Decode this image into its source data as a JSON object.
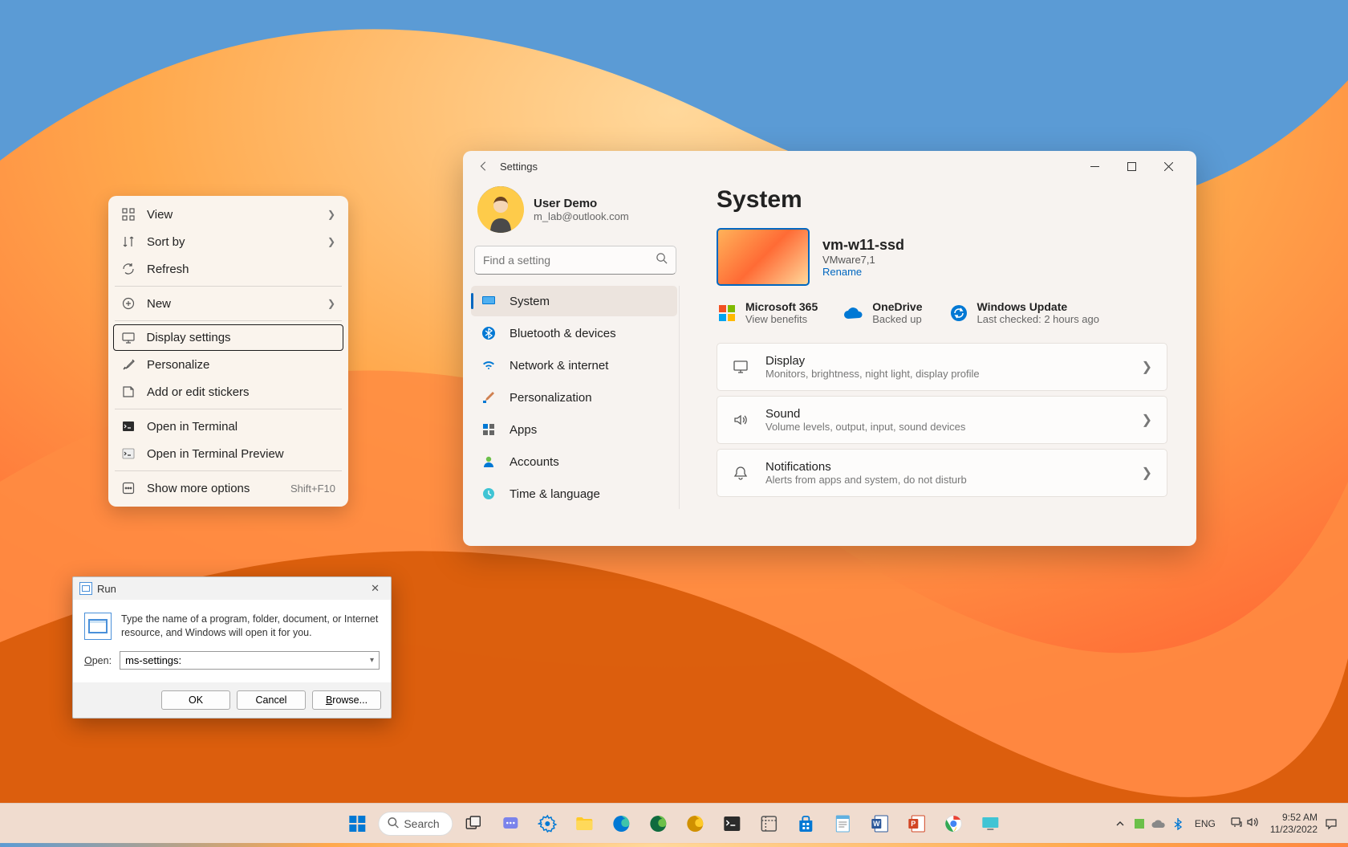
{
  "context_menu": {
    "items": [
      {
        "label": "View",
        "icon": "grid",
        "has_submenu": true
      },
      {
        "label": "Sort by",
        "icon": "sort",
        "has_submenu": true
      },
      {
        "label": "Refresh",
        "icon": "refresh"
      },
      {
        "sep": true
      },
      {
        "label": "New",
        "icon": "plus-circle",
        "has_submenu": true
      },
      {
        "sep": true
      },
      {
        "label": "Display settings",
        "icon": "display",
        "selected": true
      },
      {
        "label": "Personalize",
        "icon": "brush"
      },
      {
        "label": "Add or edit stickers",
        "icon": "sticker"
      },
      {
        "sep": true
      },
      {
        "label": "Open in Terminal",
        "icon": "terminal-dark"
      },
      {
        "label": "Open in Terminal Preview",
        "icon": "terminal-light"
      },
      {
        "sep": true
      },
      {
        "label": "Show more options",
        "icon": "more",
        "shortcut": "Shift+F10"
      }
    ]
  },
  "settings": {
    "window_title": "Settings",
    "user": {
      "name": "User Demo",
      "email": "m_lab@outlook.com"
    },
    "search_placeholder": "Find a setting",
    "nav": [
      {
        "label": "System",
        "icon": "system",
        "active": true
      },
      {
        "label": "Bluetooth & devices",
        "icon": "bluetooth"
      },
      {
        "label": "Network & internet",
        "icon": "wifi"
      },
      {
        "label": "Personalization",
        "icon": "brush"
      },
      {
        "label": "Apps",
        "icon": "apps"
      },
      {
        "label": "Accounts",
        "icon": "accounts"
      },
      {
        "label": "Time & language",
        "icon": "time"
      }
    ],
    "main_title": "System",
    "device": {
      "name": "vm-w11-ssd",
      "model": "VMware7,1",
      "rename": "Rename"
    },
    "quick_links": [
      {
        "title": "Microsoft 365",
        "sub": "View benefits",
        "icon": "m365"
      },
      {
        "title": "OneDrive",
        "sub": "Backed up",
        "icon": "onedrive"
      },
      {
        "title": "Windows Update",
        "sub": "Last checked: 2 hours ago",
        "icon": "update"
      }
    ],
    "rows": [
      {
        "title": "Display",
        "sub": "Monitors, brightness, night light, display profile",
        "icon": "display"
      },
      {
        "title": "Sound",
        "sub": "Volume levels, output, input, sound devices",
        "icon": "sound"
      },
      {
        "title": "Notifications",
        "sub": "Alerts from apps and system, do not disturb",
        "icon": "bell"
      }
    ]
  },
  "run": {
    "title": "Run",
    "description": "Type the name of a program, folder, document, or Internet resource, and Windows will open it for you.",
    "open_label": "Open:",
    "value": "ms-settings:",
    "buttons": {
      "ok": "OK",
      "cancel": "Cancel",
      "browse": "Browse..."
    }
  },
  "taskbar": {
    "search_label": "Search",
    "apps": [
      "start",
      "search",
      "taskview",
      "chat",
      "settings-gear",
      "explorer",
      "edge",
      "edge-dev",
      "edge-canary",
      "terminal",
      "snip",
      "store",
      "notepad",
      "word",
      "powerpoint",
      "edge-beta",
      "desktop"
    ],
    "tray": {
      "lang": "ENG",
      "time": "9:52 AM",
      "date": "11/23/2022"
    }
  }
}
